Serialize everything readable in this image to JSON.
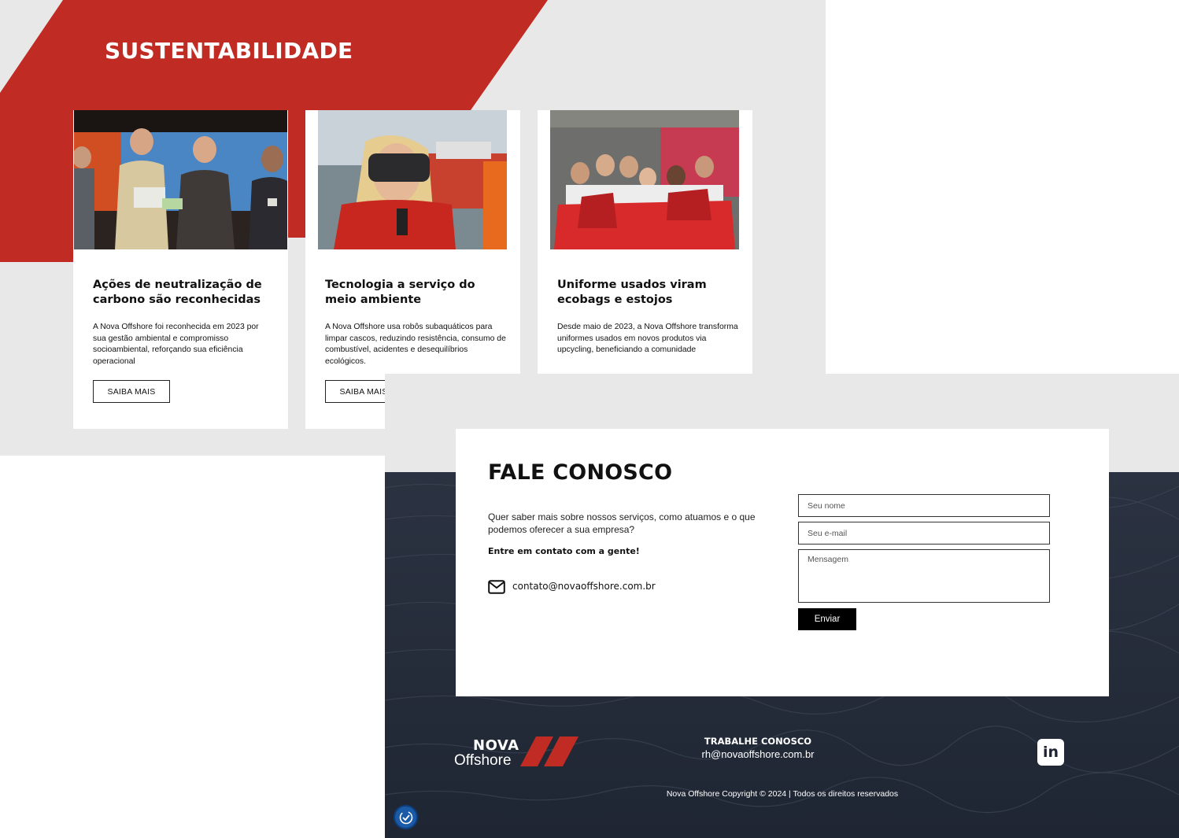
{
  "colors": {
    "brand_red": "#c02b23",
    "sea_dark": "#232a38",
    "panel_bg": "#e8e8e8"
  },
  "sustentabilidade": {
    "title": "SUSTENTABILIDADE",
    "cards": [
      {
        "image": "award-ceremony-photo",
        "title": "Ações de neutralização de carbono são reconhecidas",
        "text": "A Nova Offshore foi reconhecida em 2023 por sua gestão ambiental e compromisso socioambiental, reforçando sua eficiência operacional",
        "button": "SAIBA MAIS"
      },
      {
        "image": "vr-headset-photo",
        "title": "Tecnologia a serviço do meio ambiente",
        "text": "A Nova Offshore usa robôs subaquáticos para limpar cascos, reduzindo resistência, consumo de combustível, acidentes e desequilíbrios ecológicos.",
        "button": "SAIBA MAIS"
      },
      {
        "image": "upcycled-uniforms-photo",
        "title": "Uniforme usados viram ecobags e estojos",
        "text": "Desde maio de 2023, a Nova Offshore transforma uniformes usados em novos produtos via upcycling, beneficiando a comunidade"
      }
    ]
  },
  "contato": {
    "title": "FALE CONOSCO",
    "intro": "Quer saber mais sobre nossos serviços, como atuamos e o que podemos oferecer a sua empresa?",
    "cta": "Entre em contato com a gente!",
    "email_icon": "envelope-icon",
    "email": "contato@novaoffshore.com.br",
    "form": {
      "name_placeholder": "Seu nome",
      "email_placeholder": "Seu e-mail",
      "message_placeholder": "Mensagem",
      "submit": "Enviar"
    }
  },
  "footer": {
    "logo_line1": "NOVA",
    "logo_line2": "Offshore",
    "work_title": "TRABALHE CONOSCO",
    "work_email": "rh@novaoffshore.com.br",
    "linkedin_label": "in",
    "copyright": "Nova Offshore Copyright © 2024 | Todos os direitos reservados",
    "accessibility_icon": "accessibility-icon"
  }
}
